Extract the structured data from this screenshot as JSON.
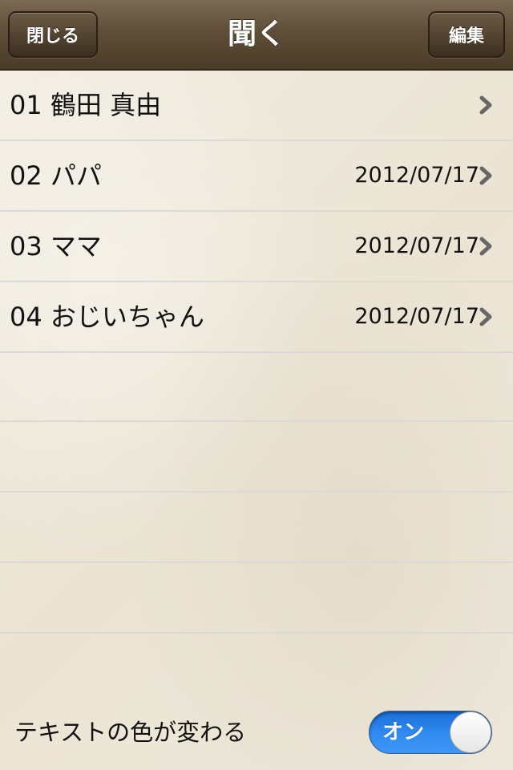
{
  "nav": {
    "close_label": "閉じる",
    "title": "聞く",
    "edit_label": "編集"
  },
  "list": {
    "items": [
      {
        "label": "01 鶴田 真由",
        "date": ""
      },
      {
        "label": "02 パパ",
        "date": "2012/07/17"
      },
      {
        "label": "03 ママ",
        "date": "2012/07/17"
      },
      {
        "label": "04 おじいちゃん",
        "date": "2012/07/17"
      }
    ]
  },
  "footer": {
    "toggle_label": "テキストの色が変わる",
    "toggle_state": "オン",
    "toggle_on": true
  },
  "colors": {
    "nav_brown": "#5f4e38",
    "toggle_blue": "#2f8af0",
    "divider": "#dcd8d6",
    "chevron": "#666666"
  },
  "icons": {
    "row_disclosure": "chevron-right-icon"
  }
}
